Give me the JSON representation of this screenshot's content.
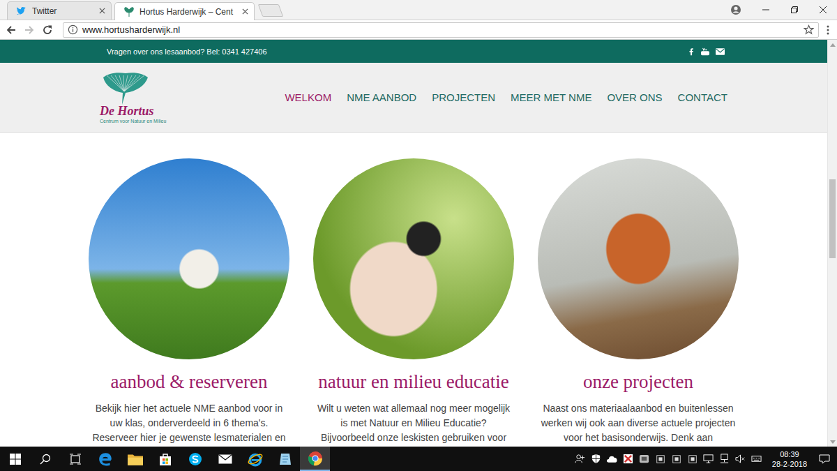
{
  "browser": {
    "tabs": [
      {
        "label": "Twitter",
        "selected": false,
        "kind": "twitter"
      },
      {
        "label": "Hortus Harderwijk – Cent",
        "selected": true,
        "kind": "hortus"
      }
    ],
    "address": "www.hortusharderwijk.nl",
    "forward_disabled": true
  },
  "site": {
    "topbar": {
      "text": "Vragen over ons lesaanbod? Bel: 0341 427406",
      "social": [
        {
          "kind": "facebook"
        },
        {
          "kind": "youtube"
        },
        {
          "kind": "mail"
        }
      ]
    },
    "logo": {
      "title": "De Hortus",
      "subtitle": "Centrum voor Natuur en Milieu"
    },
    "nav": [
      {
        "label": "WELKOM",
        "selected": true
      },
      {
        "label": "NME AANBOD",
        "selected": false
      },
      {
        "label": "PROJECTEN",
        "selected": false
      },
      {
        "label": "MEER MET NME",
        "selected": false
      },
      {
        "label": "OVER ONS",
        "selected": false
      },
      {
        "label": "CONTACT",
        "selected": false
      }
    ],
    "cards": [
      {
        "title": "aanbod & reserveren",
        "lines": [
          "Bekijk hier het actuele NME aanbod voor in",
          "uw klas, onderverdeeld in 6 thema's.",
          "Reserveer hier je gewenste lesmaterialen en"
        ]
      },
      {
        "title": "natuur en milieu educatie",
        "lines": [
          "Wilt u weten wat allemaal nog meer mogelijk",
          "is met Natuur en Milieu Educatie?",
          "Bijvoorbeeld onze leskisten gebruiken voor"
        ]
      },
      {
        "title": "onze projecten",
        "lines": [
          "Naast ons materiaalaanbod en buitenlessen",
          "werken wij ook aan diverse actuele projecten",
          "voor het basisonderwijs. Denk aan"
        ]
      }
    ]
  },
  "scrollbar": {
    "level": 0.42
  },
  "taskbar": {
    "apps": [
      {
        "kind": "edge",
        "selected": false
      },
      {
        "kind": "explorer",
        "selected": false
      },
      {
        "kind": "store",
        "selected": false
      },
      {
        "kind": "skype",
        "selected": false
      },
      {
        "kind": "mail",
        "selected": false
      },
      {
        "kind": "ie",
        "selected": false
      },
      {
        "kind": "notes",
        "selected": false
      },
      {
        "kind": "chrome",
        "selected": true
      }
    ],
    "tray": [
      {
        "kind": "people"
      },
      {
        "kind": "shield"
      },
      {
        "kind": "cloud"
      },
      {
        "kind": "antivirus"
      },
      {
        "kind": "app"
      },
      {
        "kind": "box"
      },
      {
        "kind": "box"
      },
      {
        "kind": "box"
      },
      {
        "kind": "monitor"
      },
      {
        "kind": "network"
      },
      {
        "kind": "volume"
      },
      {
        "kind": "keyboard"
      }
    ],
    "time": "08:39",
    "date": "28-2-2018"
  }
}
